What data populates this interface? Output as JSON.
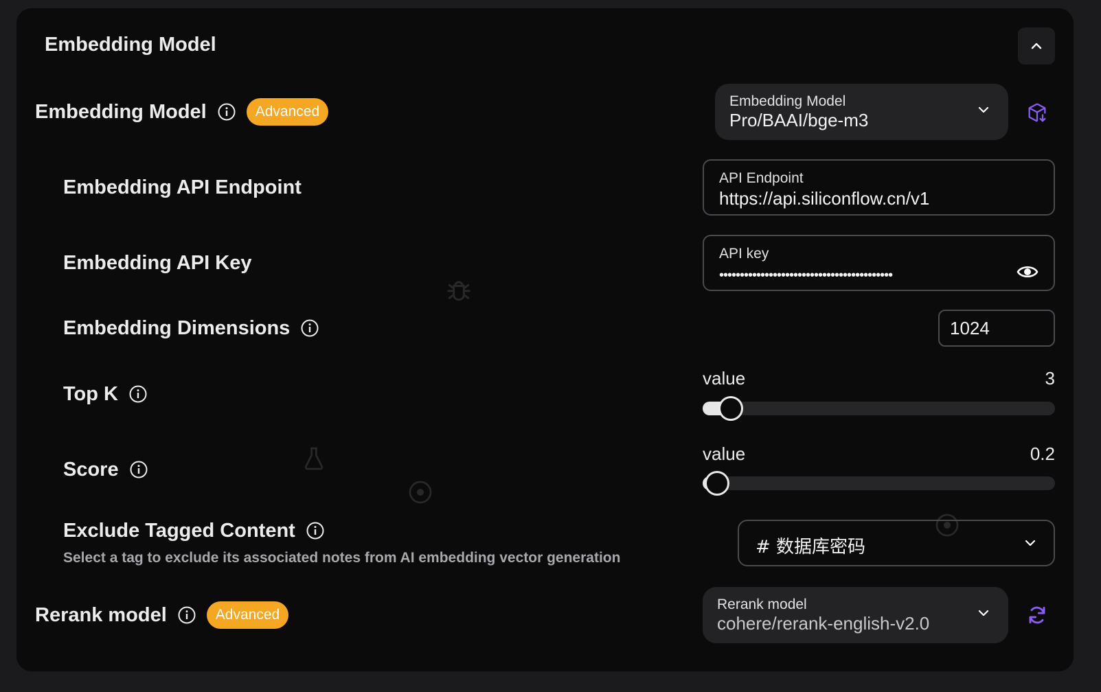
{
  "section": {
    "title": "Embedding Model"
  },
  "embedding_model": {
    "label": "Embedding Model",
    "badge": "Advanced",
    "select_label": "Embedding Model",
    "select_value": "Pro/BAAI/bge-m3"
  },
  "api_endpoint": {
    "label": "Embedding API Endpoint",
    "field_label": "API Endpoint",
    "value": "https://api.siliconflow.cn/v1"
  },
  "api_key": {
    "label": "Embedding API Key",
    "field_label": "API key",
    "masked_value": "••••••••••••••••••••••••••••••••••••••••••"
  },
  "dimensions": {
    "label": "Embedding Dimensions",
    "value": "1024"
  },
  "top_k": {
    "label": "Top K",
    "slider_label": "value",
    "value": "3",
    "fill_fraction": 0.08
  },
  "score": {
    "label": "Score",
    "slider_label": "value",
    "value": "0.2",
    "fill_fraction": 0.04
  },
  "exclude_tagged": {
    "label": "Exclude Tagged Content",
    "description": "Select a tag to exclude its associated notes from AI embedding vector generation",
    "selected_tag": "# 数据库密码"
  },
  "rerank_model": {
    "label": "Rerank model",
    "badge": "Advanced",
    "select_label": "Rerank model",
    "select_value": "cohere/rerank-english-v2.0"
  },
  "colors": {
    "accent": "#8b5cf6",
    "badge": "#f5a623",
    "panel": "#0b0b0c"
  }
}
